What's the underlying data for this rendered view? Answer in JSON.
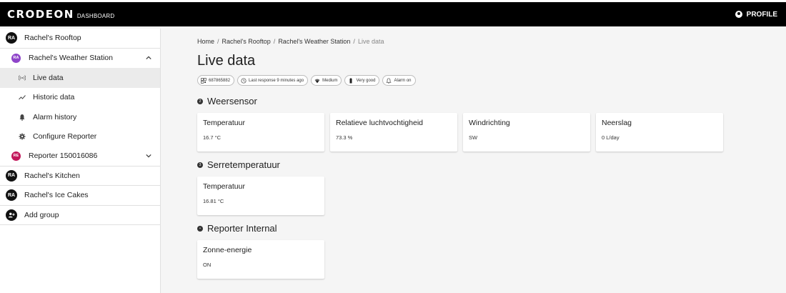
{
  "topbar": {
    "logo": "CRODEON",
    "subtitle": "DASHBOARD",
    "profile_label": "PROFILE",
    "profile_icon": "account-circle-icon"
  },
  "sidebar": {
    "items": [
      {
        "avatar": "RA",
        "label": "Rachel's Rooftop"
      },
      {
        "avatar": "RA",
        "label": "Rachel's Weather Station",
        "avatar_color": "#8e44c9",
        "expanded": true
      },
      {
        "icon": "broadcast-icon",
        "label": "Live data",
        "active": true
      },
      {
        "icon": "trend-icon",
        "label": "Historic data"
      },
      {
        "icon": "bell-icon",
        "label": "Alarm history"
      },
      {
        "icon": "gear-icon",
        "label": "Configure Reporter"
      },
      {
        "avatar": "RE",
        "label": "Reporter 150016086",
        "avatar_color": "#c2185b",
        "expanded": false
      },
      {
        "avatar": "RA",
        "label": "Rachel's Kitchen"
      },
      {
        "avatar": "RA",
        "label": "Rachel's Ice Cakes"
      },
      {
        "icon": "add-group-icon",
        "label": "Add group"
      }
    ]
  },
  "breadcrumb": {
    "items": [
      "Home",
      "Rachel's Rooftop",
      "Rachel's Weather Station",
      "Live data"
    ],
    "separator": "/"
  },
  "page_title": "Live data",
  "chips": [
    {
      "icon": "qr-icon",
      "text": "687865882"
    },
    {
      "icon": "history-icon",
      "text": "Last response 9 minutes ago"
    },
    {
      "icon": "wifi-icon",
      "text": "Medium"
    },
    {
      "icon": "battery-icon",
      "text": "Very good"
    },
    {
      "icon": "bell-icon",
      "text": "Alarm on"
    }
  ],
  "sections": [
    {
      "title": "Weersensor",
      "bullet": "2",
      "cards": [
        {
          "label": "Temperatuur",
          "value": "16.7 °C"
        },
        {
          "label": "Relatieve luchtvochtigheid",
          "value": "73.3 %"
        },
        {
          "label": "Windrichting",
          "value": "SW"
        },
        {
          "label": "Neerslag",
          "value": "0 L/day"
        }
      ]
    },
    {
      "title": "Serretemperatuur",
      "bullet": "3",
      "cards": [
        {
          "label": "Temperatuur",
          "value": "16.81 °C"
        }
      ]
    },
    {
      "title": "Reporter Internal",
      "bullet": "•",
      "cards": [
        {
          "label": "Zonne-energie",
          "value": "ON"
        }
      ]
    }
  ]
}
